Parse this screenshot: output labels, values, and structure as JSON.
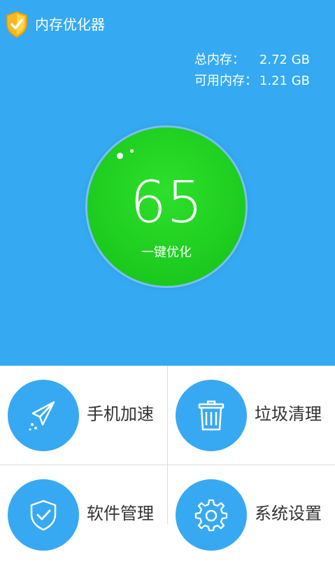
{
  "app": {
    "title": "内存优化器",
    "logo_icon": "shield-check-icon"
  },
  "memory": {
    "total_label": "总内存：",
    "total_value": "2.72 GB",
    "available_label": "可用内存：",
    "available_value": "1.21 GB"
  },
  "optimizer": {
    "score": "65",
    "button_label": "一键优化",
    "color": "#1fcf21"
  },
  "tiles": [
    {
      "label": "手机加速",
      "icon": "paper-plane-icon"
    },
    {
      "label": "垃圾清理",
      "icon": "trash-can-icon"
    },
    {
      "label": "软件管理",
      "icon": "shield-check-icon"
    },
    {
      "label": "系统设置",
      "icon": "gear-icon"
    }
  ],
  "colors": {
    "header_bg": "#35aaf3",
    "accent": "#37a9f3",
    "orb_green": "#1fcf21"
  }
}
